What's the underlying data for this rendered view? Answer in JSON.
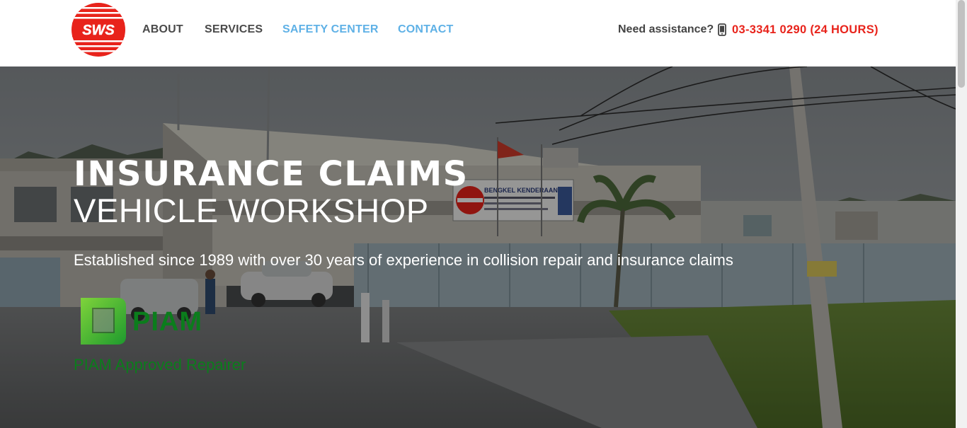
{
  "brand": {
    "logo_text": "SWS",
    "logo_color": "#e8231b"
  },
  "nav": {
    "items": [
      {
        "label": "ABOUT"
      },
      {
        "label": "SERVICES"
      },
      {
        "label": "SAFETY CENTER"
      },
      {
        "label": "CONTACT"
      }
    ]
  },
  "header": {
    "assist_label": "Need assistance?",
    "phone": "03-3341 0290 (24 HOURS)",
    "phone_icon": "mobile-phone-icon",
    "phone_color": "#e8231b",
    "nav_active_color": "#5fb1e6"
  },
  "hero": {
    "title_line1": "INSURANCE CLAIMS",
    "title_line2": "VEHICLE WORKSHOP",
    "subtitle": "Established since 1989 with over 30 years of experience in collision repair and insurance claims",
    "signboard_text": "BENGKEL KENDERAAN",
    "badge_text": "PIAM",
    "badge_caption": "PIAM Approved Repairer",
    "badge_color": "#0b7d1c"
  }
}
